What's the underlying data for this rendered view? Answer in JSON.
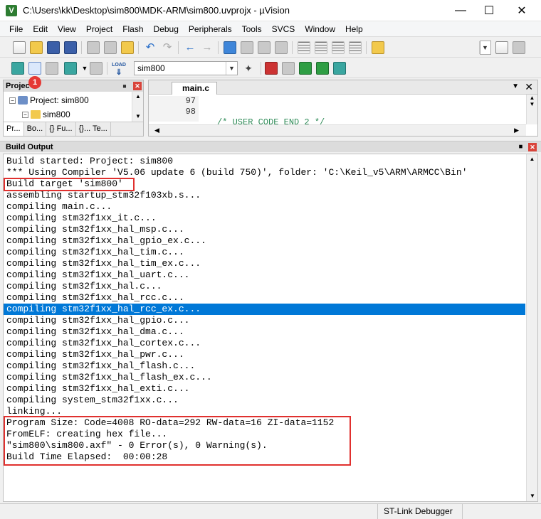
{
  "window": {
    "title": "C:\\Users\\kk\\Desktop\\sim800\\MDK-ARM\\sim800.uvprojx - µVision",
    "icon_glyph": "V"
  },
  "menu": [
    "File",
    "Edit",
    "View",
    "Project",
    "Flash",
    "Debug",
    "Peripherals",
    "Tools",
    "SVCS",
    "Window",
    "Help"
  ],
  "toolbar2": {
    "load_label": "LOAD",
    "target_select": "sim800",
    "badge_number": "1"
  },
  "project_panel": {
    "title": "Projec",
    "tree": [
      {
        "label": "Project: sim800",
        "toggle": "−"
      },
      {
        "label": "sim800",
        "toggle": "−"
      }
    ],
    "tabs": [
      "Pr...",
      "Bo...",
      "{} Fu...",
      "{}... Te..."
    ]
  },
  "editor": {
    "tab_label": "main.c",
    "line_numbers": [
      "97",
      "98"
    ],
    "code_lines": [
      "/* USER CODE END 2 */",
      ""
    ]
  },
  "build_output": {
    "title": "Build Output",
    "lines": [
      "Build started: Project: sim800",
      "*** Using Compiler 'V5.06 update 6 (build 750)', folder: 'C:\\Keil_v5\\ARM\\ARMCC\\Bin'",
      "Build target 'sim800'",
      "assembling startup_stm32f103xb.s...",
      "compiling main.c...",
      "compiling stm32f1xx_it.c...",
      "compiling stm32f1xx_hal_msp.c...",
      "compiling stm32f1xx_hal_gpio_ex.c...",
      "compiling stm32f1xx_hal_tim.c...",
      "compiling stm32f1xx_hal_tim_ex.c...",
      "compiling stm32f1xx_hal_uart.c...",
      "compiling stm32f1xx_hal.c...",
      "compiling stm32f1xx_hal_rcc.c...",
      "compiling stm32f1xx_hal_rcc_ex.c...",
      "compiling stm32f1xx_hal_gpio.c...",
      "compiling stm32f1xx_hal_dma.c...",
      "compiling stm32f1xx_hal_cortex.c...",
      "compiling stm32f1xx_hal_pwr.c...",
      "compiling stm32f1xx_hal_flash.c...",
      "compiling stm32f1xx_hal_flash_ex.c...",
      "compiling stm32f1xx_hal_exti.c...",
      "compiling system_stm32f1xx.c...",
      "linking...",
      "Program Size: Code=4008 RO-data=292 RW-data=16 ZI-data=1152",
      "FromELF: creating hex file...",
      "\"sim800\\sim800.axf\" - 0 Error(s), 0 Warning(s).",
      "Build Time Elapsed:  00:00:28"
    ],
    "selected_line": "compiling stm32f1xx_hal_rcc_ex.c..."
  },
  "status": {
    "debugger": "ST-Link Debugger"
  },
  "colors": {
    "selection": "#0078d7",
    "highlight_box": "#e0302e",
    "comment": "#2e8b57"
  }
}
